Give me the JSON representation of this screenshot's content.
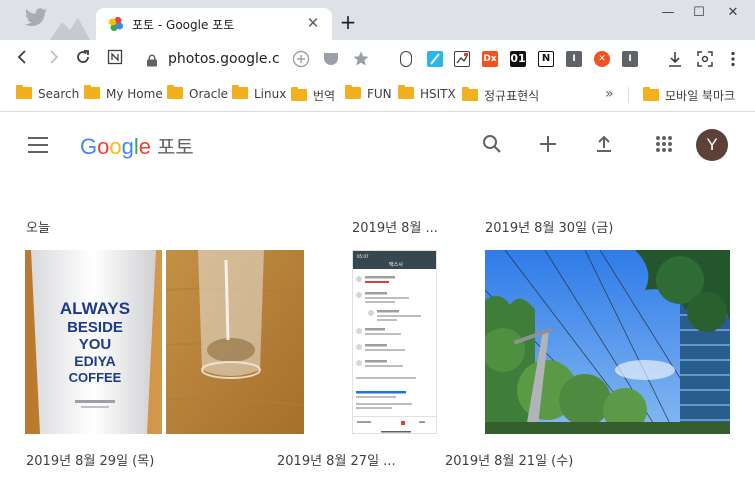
{
  "browser": {
    "tab_title": "포토 - Google 포토",
    "tab_close": "✕",
    "new_tab": "+",
    "url": "photos.google.com",
    "window": {
      "minimize": "—",
      "maximize": "☐",
      "close": "✕"
    }
  },
  "bookmarks": [
    {
      "label": "Search"
    },
    {
      "label": "My Home"
    },
    {
      "label": "Oracle"
    },
    {
      "label": "Linux"
    },
    {
      "label": "번역"
    },
    {
      "label": "FUN"
    },
    {
      "label": "HSITX"
    },
    {
      "label": "정규표현식"
    }
  ],
  "bookmarks_more": "»",
  "bookmarks_other": "모바일 북마크",
  "extensions": [
    {
      "name": "mouse-extension-icon",
      "label": "",
      "color": "#ffffff"
    },
    {
      "name": "feather-extension-icon",
      "label": "",
      "color": "#29b6e8"
    },
    {
      "name": "picture-extension-icon",
      "label": "",
      "color": "#ffffff"
    },
    {
      "name": "dx-extension-icon",
      "label": "Dx",
      "color": "#f4511e"
    },
    {
      "name": "01-extension-icon",
      "label": "01",
      "color": "#111111"
    },
    {
      "name": "notion-extension-icon",
      "label": "N",
      "color": "#ffffff"
    },
    {
      "name": "i-extension-icon",
      "label": "I",
      "color": "#5f6368"
    },
    {
      "name": "x-extension-icon",
      "label": "✕",
      "color": "#f4511e"
    },
    {
      "name": "i2-extension-icon",
      "label": "I",
      "color": "#5f6368"
    }
  ],
  "app": {
    "logo_google": [
      "G",
      "o",
      "o",
      "g",
      "l",
      "e"
    ],
    "product_name": "포토",
    "avatar_letter": "Y"
  },
  "sections": [
    {
      "title": "오늘"
    },
    {
      "title": "2019년 8월 ..."
    },
    {
      "title": "2019년 8월 30일 (금)"
    },
    {
      "title": "2019년 8월 29일 (목)"
    },
    {
      "title": "2019년 8월 27일 ..."
    },
    {
      "title": "2019년 8월 21일 (수)"
    }
  ],
  "cup_text": [
    "ALWAYS",
    "BESIDE",
    "YOU",
    "EDIYA",
    "COFFEE"
  ],
  "phone": {
    "status_time": "05:07",
    "header": "택스시"
  },
  "colors": {
    "chrome_bg": "#dee1e6",
    "accent_blue": "#1a73e8",
    "folder": "#f2b01e",
    "avatar": "#5d4037"
  }
}
